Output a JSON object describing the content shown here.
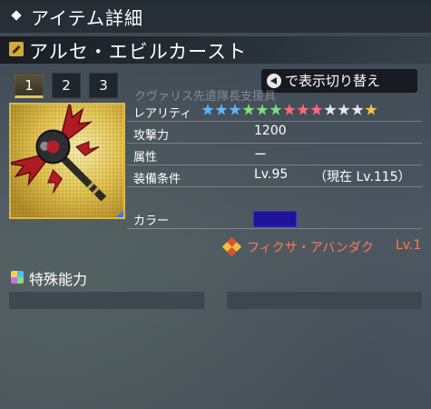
{
  "window": {
    "title": "アイテム詳細"
  },
  "item": {
    "name": "アルセ・エビルカースト",
    "tabs": [
      "1",
      "2",
      "3"
    ],
    "active_tab": "1",
    "overlay_text": "クヴァリス先遣隊長支援具",
    "toggle_label": "で表示切り替え"
  },
  "stats": {
    "rarity_label": "レアリティ",
    "rarity_stars": 13,
    "attack_label": "攻撃力",
    "attack_value": "1200",
    "attribute_label": "属性",
    "attribute_value": "ー",
    "requirement_label": "装備条件",
    "requirement_value": "Lv.95",
    "requirement_current": "（現在 Lv.115）",
    "color_label": "カラー",
    "color_value": "#20129a"
  },
  "fixa": {
    "name": "フィクサ・アバンダク",
    "level": "Lv.1"
  },
  "special": {
    "title": "特殊能力"
  },
  "colors": {
    "star_colors": [
      "#5fb8ff",
      "#5fb8ff",
      "#5fb8ff",
      "#7de07a",
      "#7de07a",
      "#7de07a",
      "#ff6a7a",
      "#ff6a7a",
      "#ff6a7a",
      "#e8e8f0",
      "#e8e8f0",
      "#e8e8f0",
      "#f0c840"
    ],
    "frame_gold": "#d9b94a",
    "fixa_text": "#ff7a52"
  }
}
